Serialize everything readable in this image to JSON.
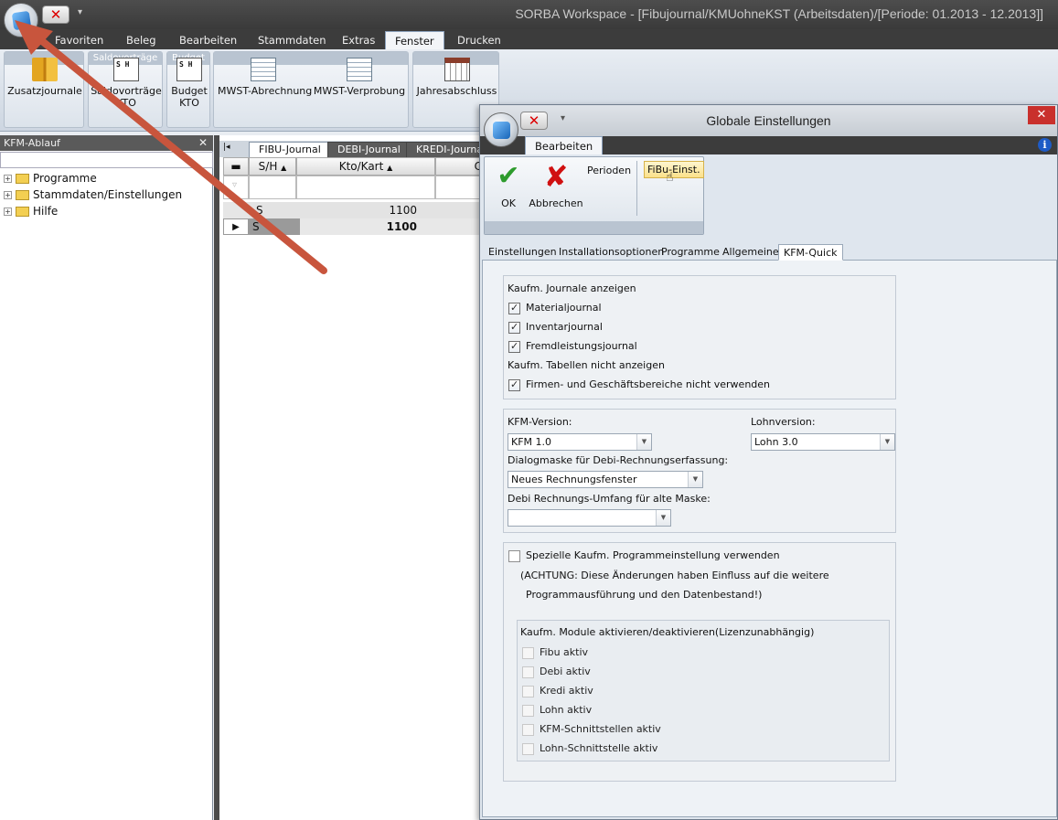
{
  "window": {
    "title": "SORBA Workspace - [Fibujournal/KMUohneKST (Arbeitsdaten)/[Periode: 01.2013 - 12.2013]]"
  },
  "ribbon_tabs": [
    "Favoriten",
    "Beleg",
    "Bearbeiten",
    "Stammdaten",
    "Extras",
    "Fenster",
    "Drucken"
  ],
  "ribbon_active_tab": "Fenster",
  "ribbon": {
    "zusatzjournale": "Zusatzjournale",
    "saldo_line1": "Saldovorträge",
    "saldo_line2": "KTO",
    "saldo_group": "Saldovorträge",
    "budget_line1": "Budget",
    "budget_line2": "KTO",
    "budget_group": "Budget",
    "mwst_abrechnung": "MWST-Abrechnung",
    "mwst_verprobung": "MWST-Verprobung",
    "jahresabschluss": "Jahresabschluss"
  },
  "left_panel": {
    "title": "KFM-Ablauf",
    "close": "✕",
    "tree": [
      "Programme",
      "Stammdaten/Einstellungen",
      "Hilfe"
    ]
  },
  "grid": {
    "tabs": [
      "FIBU-Journal",
      "DEBI-Journal",
      "KREDI-Journal"
    ],
    "columns": [
      "S/H",
      "Kto/Kart",
      "C"
    ],
    "rows": [
      {
        "sh": "S",
        "kto": "1100"
      },
      {
        "sh": "S",
        "kto": "1100"
      }
    ]
  },
  "dialog": {
    "title": "Globale Einstellungen",
    "close": "✕",
    "ribbon_tab": "Bearbeiten",
    "ok": "OK",
    "cancel": "Abbrechen",
    "perioden": "Perioden",
    "fibu_einst": "FiBu-Einst.",
    "tabs": [
      "Einstellungen",
      "Installationsoptionen",
      "Programme",
      "Allgemeines",
      "KFM-Quick"
    ],
    "active_tab": "KFM-Quick",
    "journals_heading": "Kaufm. Journale anzeigen",
    "journals": [
      {
        "label": "Materialjournal",
        "checked": true
      },
      {
        "label": "Inventarjournal",
        "checked": true
      },
      {
        "label": "Fremdleistungsjournal",
        "checked": true
      }
    ],
    "tables_heading": "Kaufm. Tabellen nicht anzeigen",
    "firmen": {
      "label": "Firmen- und Geschäftsbereiche nicht verwenden",
      "checked": true
    },
    "kfm_version_label": "KFM-Version:",
    "kfm_version_value": "KFM 1.0",
    "lohn_version_label": "Lohnversion:",
    "lohn_version_value": "Lohn 3.0",
    "dialogmaske_label": "Dialogmaske für Debi-Rechnungserfassung:",
    "dialogmaske_value": "Neues Rechnungsfenster",
    "debi_umfang_label": "Debi Rechnungs-Umfang für alte Maske:",
    "debi_umfang_value": "",
    "spezielle": {
      "label": "Spezielle Kaufm. Programmeinstellung verwenden",
      "checked": false
    },
    "warning_line1": "(ACHTUNG: Diese Änderungen haben Einfluss auf die weitere",
    "warning_line2": "Programmausführung und den Datenbestand!)",
    "modules_heading": "Kaufm. Module aktivieren/deaktivieren(Lizenzunabhängig)",
    "modules": [
      {
        "label": "Fibu aktiv",
        "checked": false
      },
      {
        "label": "Debi aktiv",
        "checked": false
      },
      {
        "label": "Kredi aktiv",
        "checked": false
      },
      {
        "label": "Lohn aktiv",
        "checked": false
      },
      {
        "label": "KFM-Schnittstellen aktiv",
        "checked": false
      },
      {
        "label": "Lohn-Schnittstelle aktiv",
        "checked": false
      }
    ]
  },
  "colors": {
    "annotation_arrow": "#c8553d",
    "accent": "#1e5bc6"
  }
}
